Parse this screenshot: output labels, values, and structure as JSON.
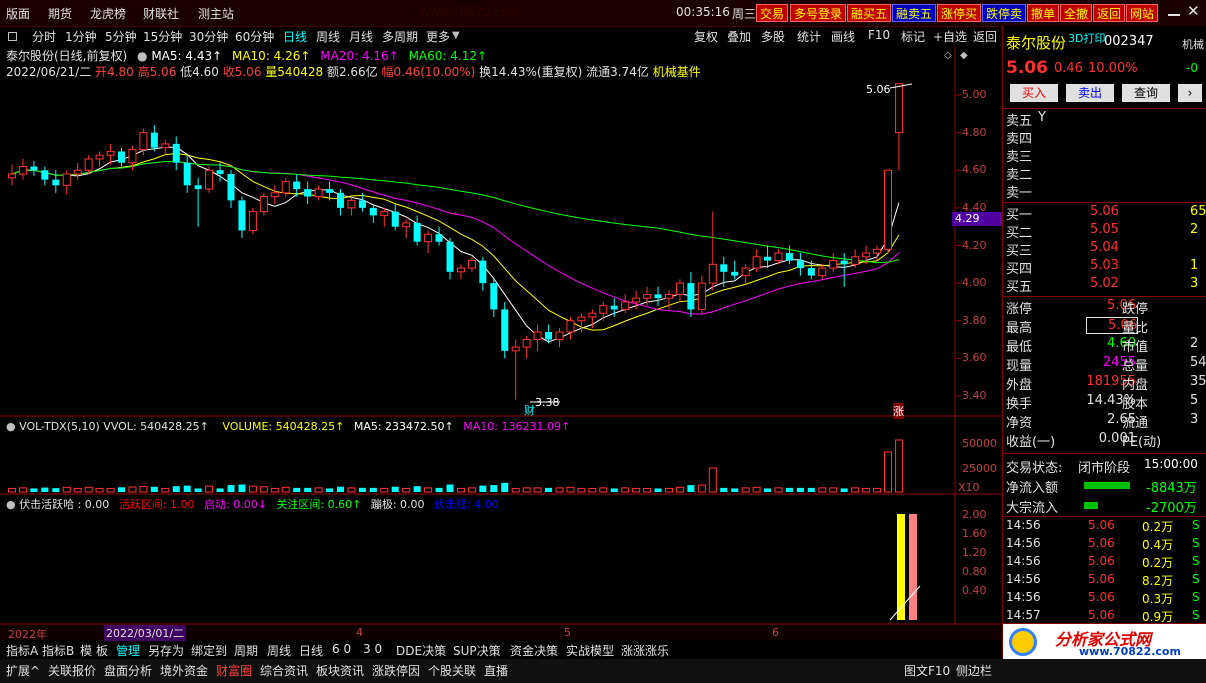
{
  "topbar": {
    "menus": [
      "版面",
      "期货",
      "龙虎榜",
      "财联社",
      "测主站"
    ],
    "watermark": "www.70822.com",
    "time": "00:35:16",
    "weekday": "周三",
    "buttons": [
      "交易",
      "多号登录",
      "融买五",
      "融卖五",
      "涨停买",
      "跌停卖",
      "撤单",
      "全撤",
      "返回",
      "网站"
    ]
  },
  "periods": [
    "分时",
    "1分钟",
    "5分钟",
    "15分钟",
    "30分钟",
    "60分钟",
    "日线",
    "周线",
    "月线",
    "多周期",
    "更多"
  ],
  "active_period": "日线",
  "right_tools": [
    "复权",
    "叠加",
    "多股",
    "统计",
    "画线",
    "F10",
    "标记",
    "+自选",
    "返回"
  ],
  "chart_info": {
    "stock_line": "泰尔股份(日线,前复权)",
    "ma5": "MA5: 4.43↑",
    "ma10": "MA10: 4.26↑",
    "ma20": "MA20: 4.16↑",
    "ma60": "MA60: 4.12↑",
    "date": "2022/06/21/二",
    "open": "开4.80",
    "high": "高5.06",
    "low": "低4.60",
    "close": "收5.06",
    "vol": "量540428",
    "amt": "额2.66亿",
    "chg": "幅0.46(10.00%)",
    "turnover": "换14.43%(重复权)",
    "float": "流通3.74亿",
    "sector": "机械基件"
  },
  "chart_data": {
    "type": "candlestick",
    "y_ticks": [
      "5.00",
      "4.80",
      "4.60",
      "4.40",
      "4.20",
      "4.00",
      "3.80",
      "3.60",
      "3.40"
    ],
    "annotations": {
      "high_label": "5.06",
      "low_label": "3.38",
      "current_price": "4.29",
      "cai": "财",
      "zhang": "涨"
    },
    "candles": [
      [
        4.56,
        4.63,
        4.52,
        4.58
      ],
      [
        4.58,
        4.66,
        4.55,
        4.62
      ],
      [
        4.62,
        4.65,
        4.57,
        4.6
      ],
      [
        4.6,
        4.62,
        4.52,
        4.55
      ],
      [
        4.55,
        4.6,
        4.48,
        4.52
      ],
      [
        4.52,
        4.6,
        4.47,
        4.58
      ],
      [
        4.58,
        4.64,
        4.55,
        4.6
      ],
      [
        4.6,
        4.68,
        4.58,
        4.66
      ],
      [
        4.66,
        4.7,
        4.62,
        4.68
      ],
      [
        4.68,
        4.74,
        4.63,
        4.7
      ],
      [
        4.7,
        4.72,
        4.62,
        4.64
      ],
      [
        4.64,
        4.73,
        4.6,
        4.71
      ],
      [
        4.71,
        4.82,
        4.68,
        4.8
      ],
      [
        4.8,
        4.84,
        4.7,
        4.72
      ],
      [
        4.72,
        4.76,
        4.68,
        4.74
      ],
      [
        4.74,
        4.78,
        4.6,
        4.64
      ],
      [
        4.64,
        4.68,
        4.48,
        4.52
      ],
      [
        4.52,
        4.56,
        4.3,
        4.5
      ],
      [
        4.5,
        4.62,
        4.48,
        4.6
      ],
      [
        4.6,
        4.64,
        4.54,
        4.58
      ],
      [
        4.58,
        4.6,
        4.4,
        4.44
      ],
      [
        4.44,
        4.46,
        4.24,
        4.28
      ],
      [
        4.28,
        4.4,
        4.26,
        4.38
      ],
      [
        4.38,
        4.48,
        4.36,
        4.46
      ],
      [
        4.46,
        4.52,
        4.42,
        4.48
      ],
      [
        4.48,
        4.56,
        4.46,
        4.54
      ],
      [
        4.54,
        4.58,
        4.46,
        4.5
      ],
      [
        4.5,
        4.54,
        4.42,
        4.46
      ],
      [
        4.46,
        4.52,
        4.44,
        4.5
      ],
      [
        4.5,
        4.54,
        4.44,
        4.48
      ],
      [
        4.48,
        4.5,
        4.36,
        4.4
      ],
      [
        4.4,
        4.46,
        4.36,
        4.44
      ],
      [
        4.44,
        4.48,
        4.38,
        4.4
      ],
      [
        4.4,
        4.42,
        4.32,
        4.36
      ],
      [
        4.36,
        4.4,
        4.3,
        4.38
      ],
      [
        4.38,
        4.42,
        4.28,
        4.3
      ],
      [
        4.3,
        4.34,
        4.24,
        4.32
      ],
      [
        4.32,
        4.36,
        4.2,
        4.22
      ],
      [
        4.22,
        4.28,
        4.16,
        4.26
      ],
      [
        4.26,
        4.3,
        4.2,
        4.22
      ],
      [
        4.22,
        4.24,
        4.02,
        4.06
      ],
      [
        4.06,
        4.1,
        4.02,
        4.08
      ],
      [
        4.08,
        4.14,
        4.06,
        4.12
      ],
      [
        4.12,
        4.14,
        3.96,
        4.0
      ],
      [
        4.0,
        4.02,
        3.82,
        3.86
      ],
      [
        3.86,
        3.9,
        3.6,
        3.64
      ],
      [
        3.64,
        3.7,
        3.38,
        3.66
      ],
      [
        3.66,
        3.72,
        3.6,
        3.7
      ],
      [
        3.7,
        3.78,
        3.64,
        3.74
      ],
      [
        3.74,
        3.78,
        3.68,
        3.7
      ],
      [
        3.7,
        3.76,
        3.66,
        3.74
      ],
      [
        3.74,
        3.82,
        3.7,
        3.8
      ],
      [
        3.8,
        3.84,
        3.74,
        3.82
      ],
      [
        3.82,
        3.86,
        3.76,
        3.84
      ],
      [
        3.84,
        3.9,
        3.8,
        3.88
      ],
      [
        3.88,
        3.92,
        3.82,
        3.86
      ],
      [
        3.86,
        3.94,
        3.84,
        3.9
      ],
      [
        3.9,
        3.96,
        3.86,
        3.92
      ],
      [
        3.92,
        3.98,
        3.88,
        3.94
      ],
      [
        3.94,
        3.98,
        3.88,
        3.92
      ],
      [
        3.92,
        3.96,
        3.86,
        3.94
      ],
      [
        3.94,
        4.02,
        3.9,
        4.0
      ],
      [
        4.0,
        4.06,
        3.82,
        3.86
      ],
      [
        3.86,
        4.04,
        3.84,
        4.0
      ],
      [
        4.0,
        4.38,
        3.96,
        4.1
      ],
      [
        4.1,
        4.14,
        3.98,
        4.06
      ],
      [
        4.06,
        4.12,
        4.02,
        4.04
      ],
      [
        4.04,
        4.1,
        4.0,
        4.08
      ],
      [
        4.08,
        4.18,
        4.06,
        4.14
      ],
      [
        4.14,
        4.2,
        4.08,
        4.12
      ],
      [
        4.12,
        4.18,
        4.1,
        4.16
      ],
      [
        4.16,
        4.2,
        4.1,
        4.12
      ],
      [
        4.12,
        4.16,
        4.04,
        4.08
      ],
      [
        4.08,
        4.12,
        4.02,
        4.04
      ],
      [
        4.04,
        4.1,
        4.02,
        4.08
      ],
      [
        4.08,
        4.16,
        4.06,
        4.12
      ],
      [
        4.12,
        4.16,
        3.98,
        4.1
      ],
      [
        4.1,
        4.18,
        4.08,
        4.14
      ],
      [
        4.14,
        4.2,
        4.1,
        4.16
      ],
      [
        4.16,
        4.2,
        4.12,
        4.18
      ],
      [
        4.18,
        4.6,
        4.16,
        4.6
      ],
      [
        4.8,
        5.06,
        4.6,
        5.06
      ]
    ],
    "vol_info": {
      "name": "VOL-TDX(5,10)",
      "vvol": "VVOL: 540428.25↑",
      "volume": "VOLUME: 540428.25↑",
      "ma5": "MA5: 233472.50↑",
      "ma10": "MA10: 136231.09↑"
    },
    "vol_ticks": [
      "50000",
      "25000",
      "X10"
    ],
    "ind_info": {
      "name": "伏击活跃哈",
      "v0": ": 0.00",
      "a": "活跃区间: 1.00",
      "b": "启动: 0.00↓",
      "c": "关注区间: 0.60↑",
      "d": "蹦极: 0.00",
      "e": "伏击线: 4.00"
    },
    "ind_ticks": [
      "2.00",
      "1.60",
      "1.20",
      "0.80",
      "0.40"
    ],
    "date_axis": [
      "2022年",
      "2022/03/01/二",
      "4",
      "5",
      "6"
    ]
  },
  "quote": {
    "name": "泰尔股份",
    "print": "3D打印",
    "code": "002347",
    "side_label": "机械",
    "price": "5.06",
    "change": "0.46",
    "pct": "10.00%",
    "side_val": "-0",
    "btn_buy": "买入",
    "btn_sell": "卖出",
    "btn_query": "查询",
    "sells": [
      "卖五",
      "卖四",
      "卖三",
      "卖二",
      "卖一"
    ],
    "sell_mark": "Y",
    "buys": [
      {
        "label": "买一",
        "price": "5.06",
        "vol": "65"
      },
      {
        "label": "买二",
        "price": "5.05",
        "vol": "2"
      },
      {
        "label": "买三",
        "price": "5.04",
        "vol": ""
      },
      {
        "label": "买四",
        "price": "5.03",
        "vol": "1"
      },
      {
        "label": "买五",
        "price": "5.02",
        "vol": "3"
      }
    ],
    "stats": [
      {
        "l": "涨停",
        "v": "5.06",
        "l2": "跌停",
        "v2": ""
      },
      {
        "l": "最高",
        "v": "5.06",
        "l2": "量比",
        "v2": ""
      },
      {
        "l": "最低",
        "v": "4.60",
        "l2": "市值",
        "v2": "2"
      },
      {
        "l": "现量",
        "v": "2455",
        "l2": "总量",
        "v2": "54"
      },
      {
        "l": "外盘",
        "v": "181955",
        "l2": "内盘",
        "v2": "35"
      },
      {
        "l": "换手",
        "v": "14.43%",
        "l2": "股本",
        "v2": "5"
      },
      {
        "l": "净资",
        "v": "2.65",
        "l2": "流通",
        "v2": "3"
      },
      {
        "l": "收益(一)",
        "v": "0.001",
        "l2": "PE(动)",
        "v2": ""
      }
    ],
    "state_label": "交易状态:",
    "state": "闭市阶段",
    "state_time": "15:00:00",
    "net_in_label": "净流入额",
    "net_in": "-8843万",
    "block_label": "大宗流入",
    "block": "-2700万",
    "ticks": [
      {
        "t": "14:56",
        "p": "5.06",
        "v": "0.2万",
        "s": "S"
      },
      {
        "t": "14:56",
        "p": "5.06",
        "v": "0.4万",
        "s": "S"
      },
      {
        "t": "14:56",
        "p": "5.06",
        "v": "0.2万",
        "s": "S"
      },
      {
        "t": "14:56",
        "p": "5.06",
        "v": "8.2万",
        "s": "S"
      },
      {
        "t": "14:56",
        "p": "5.06",
        "v": "0.3万",
        "s": "S"
      },
      {
        "t": "14:57",
        "p": "5.06",
        "v": "0.9万",
        "s": "S"
      }
    ],
    "tab": "日线"
  },
  "bottom_tabs": [
    "指标A",
    "指标B",
    "模",
    "板",
    "管理",
    "另存为",
    "绑定到",
    "周期",
    "周线",
    "日线",
    "6 0",
    "3 0",
    "DDE决策",
    "SUP决策",
    "资金决策",
    "实战模型",
    "涨涨涨乐"
  ],
  "bottom_bar": [
    "扩展^",
    "关联报价",
    "盘面分析",
    "境外资金",
    "财富圈",
    "综合资讯",
    "板块资讯",
    "涨跌停因",
    "个股关联",
    "直播"
  ],
  "bottom_right": [
    "图文F10",
    "侧边栏"
  ],
  "logo": {
    "text": "分析家公式网",
    "url": "www.70822.com"
  }
}
